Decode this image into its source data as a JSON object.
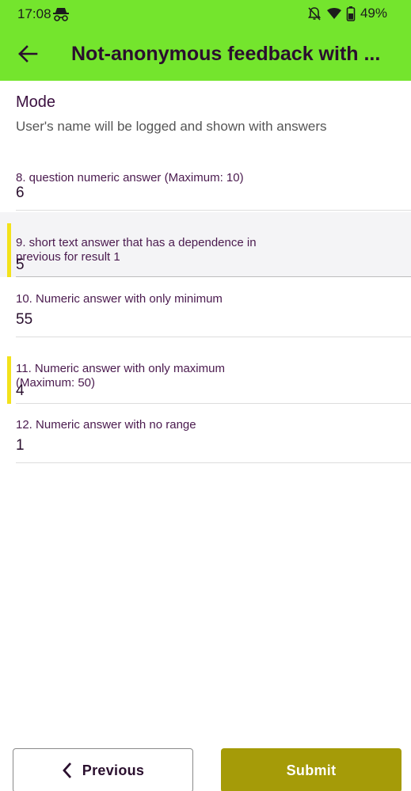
{
  "status_bar": {
    "time": "17:08",
    "battery": "49%",
    "icons": [
      "incognito-icon",
      "bell-off-icon",
      "wifi-icon",
      "battery-icon"
    ]
  },
  "toolbar": {
    "back_icon": "arrow-left-icon",
    "title": "Not-anonymous feedback with ..."
  },
  "mode": {
    "title": "Mode",
    "description": "User's name will be logged and shown with answers"
  },
  "questions": [
    {
      "label": "8. question numeric answer (Maximum: 10)",
      "value": "6",
      "highlighted": false
    },
    {
      "label_line1": "9. short text answer that has a dependence in",
      "label_line2": "previous for result 1",
      "value": "5",
      "highlighted": true
    },
    {
      "label": "10. Numeric answer with only minimum",
      "value": "55",
      "highlighted": false
    },
    {
      "label_line1": "11. Numeric answer with only maximum",
      "label_line2": "(Maximum: 50)",
      "value": "4",
      "highlighted": false,
      "flagged": true
    },
    {
      "label": "12. Numeric answer with no range",
      "value": "1",
      "highlighted": false
    }
  ],
  "buttons": {
    "previous": "Previous",
    "submit": "Submit"
  },
  "colors": {
    "header_bg": "#74e52d",
    "title_text": "#2a0f2e",
    "marker": "#f3e21b",
    "submit_bg": "#a59b08"
  }
}
